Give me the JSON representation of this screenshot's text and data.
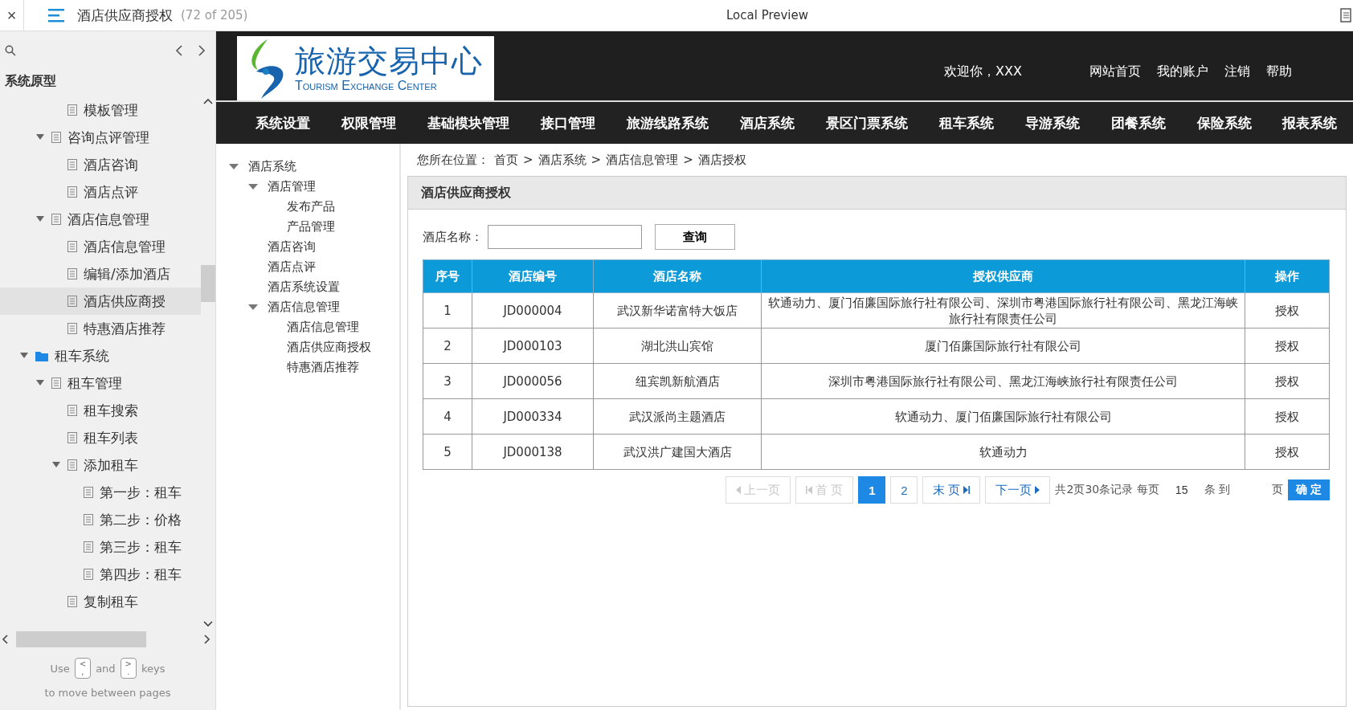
{
  "top_bar": {
    "close": "×",
    "title": "酒店供应商授权",
    "page_count": "(72 of 205)",
    "center_title": "Local Preview"
  },
  "sidebar": {
    "heading": "系统原型",
    "tree": [
      {
        "children": [
          {
            "children": [
              {
                "label": "模板管理",
                "kind": "page",
                "selected": false
              }
            ]
          },
          {
            "label": "咨询点评管理",
            "kind": "page",
            "expanded": true,
            "selected": false,
            "children": [
              {
                "label": "酒店咨询",
                "kind": "page",
                "selected": false
              },
              {
                "label": "酒店点评",
                "kind": "page",
                "selected": false
              }
            ]
          },
          {
            "label": "酒店信息管理",
            "kind": "page",
            "expanded": true,
            "selected": false,
            "children": [
              {
                "label": "酒店信息管理",
                "kind": "page",
                "selected": false
              },
              {
                "label": "编辑/添加酒店",
                "kind": "page",
                "selected": false
              },
              {
                "label": "酒店供应商授",
                "kind": "page",
                "selected": true
              },
              {
                "label": "特惠酒店推荐",
                "kind": "page",
                "selected": false
              }
            ]
          }
        ]
      },
      {
        "label": "租车系统",
        "kind": "folder",
        "expanded": true,
        "selected": false,
        "children": [
          {
            "label": "租车管理",
            "kind": "page",
            "expanded": true,
            "selected": false,
            "children": [
              {
                "label": "租车搜索",
                "kind": "page",
                "selected": false
              },
              {
                "label": "租车列表",
                "kind": "page",
                "selected": false
              },
              {
                "label": "添加租车",
                "kind": "page",
                "expanded": true,
                "selected": false,
                "children": [
                  {
                    "label": "第一步：租车",
                    "kind": "page",
                    "selected": false
                  },
                  {
                    "label": "第二步：价格",
                    "kind": "page",
                    "selected": false
                  },
                  {
                    "label": "第三步：租车",
                    "kind": "page",
                    "selected": false
                  },
                  {
                    "label": "第四步：租车",
                    "kind": "page",
                    "selected": false
                  }
                ]
              },
              {
                "label": "复制租车",
                "kind": "page",
                "selected": false
              }
            ]
          }
        ]
      }
    ],
    "footer": {
      "use": "Use",
      "key_left": {
        "top": "<",
        "bottom": ","
      },
      "and": "and",
      "key_right": {
        "top": ">",
        "bottom": "."
      },
      "keys": "keys",
      "line2": "to move between pages"
    }
  },
  "header": {
    "logo_cn": "旅游交易中心",
    "logo_en": "Tourism Exchange Center",
    "welcome": "欢迎你，XXX",
    "links": [
      "网站首页",
      "我的账户",
      "注销",
      "帮助"
    ]
  },
  "nav": [
    "系统设置",
    "权限管理",
    "基础模块管理",
    "接口管理",
    "旅游线路系统",
    "酒店系统",
    "景区门票系统",
    "租车系统",
    "导游系统",
    "团餐系统",
    "保险系统",
    "报表系统"
  ],
  "side_tree": [
    {
      "label": "酒店系统",
      "expanded": true,
      "children": [
        {
          "label": "酒店管理",
          "expanded": true,
          "children": [
            {
              "label": "发布产品"
            },
            {
              "label": "产品管理"
            }
          ]
        },
        {
          "label": "酒店咨询"
        },
        {
          "label": "酒店点评"
        },
        {
          "label": "酒店系统设置"
        },
        {
          "label": "酒店信息管理",
          "expanded": true,
          "children": [
            {
              "label": "酒店信息管理"
            },
            {
              "label": "酒店供应商授权"
            },
            {
              "label": "特惠酒店推荐"
            }
          ]
        }
      ]
    }
  ],
  "breadcrumb": {
    "prefix": "您所在位置：",
    "separator": ">",
    "items": [
      "首页",
      "酒店系统",
      "酒店信息管理",
      "酒店授权"
    ]
  },
  "panel_title": "酒店供应商授权",
  "search": {
    "label": "酒店名称：",
    "button": "查询"
  },
  "table": {
    "columns": [
      "序号",
      "酒店编号",
      "酒店名称",
      "授权供应商",
      "操作"
    ],
    "rows": [
      [
        "1",
        "JD000004",
        "武汉新华诺富特大饭店",
        "软通动力、厦门佰廉国际旅行社有限公司、深圳市粤港国际旅行社有限公司、黑龙江海峡旅行社有限责任公司",
        "授权"
      ],
      [
        "2",
        "JD000103",
        "湖北洪山宾馆",
        "厦门佰廉国际旅行社有限公司",
        "授权"
      ],
      [
        "3",
        "JD000056",
        "纽宾凯新航酒店",
        "深圳市粤港国际旅行社有限公司、黑龙江海峡旅行社有限责任公司",
        "授权"
      ],
      [
        "4",
        "JD000334",
        "武汉派尚主题酒店",
        "软通动力、厦门佰廉国际旅行社有限公司",
        "授权"
      ],
      [
        "5",
        "JD000138",
        "武汉洪广建国大酒店",
        "软通动力",
        "授权"
      ]
    ]
  },
  "pagination": {
    "prev": {
      "label": "上一页",
      "disabled": true
    },
    "first": {
      "label": "首 页",
      "disabled": true
    },
    "pages": [
      {
        "label": "1",
        "selected": true
      },
      {
        "label": "2",
        "selected": false
      }
    ],
    "last": {
      "label": "末 页",
      "disabled": false
    },
    "next": {
      "label": "下一页",
      "disabled": false
    },
    "summary": "共2页30条记录 每页",
    "per_page": "15",
    "to": "条 到",
    "page_word": "页",
    "confirm": "确 定"
  }
}
